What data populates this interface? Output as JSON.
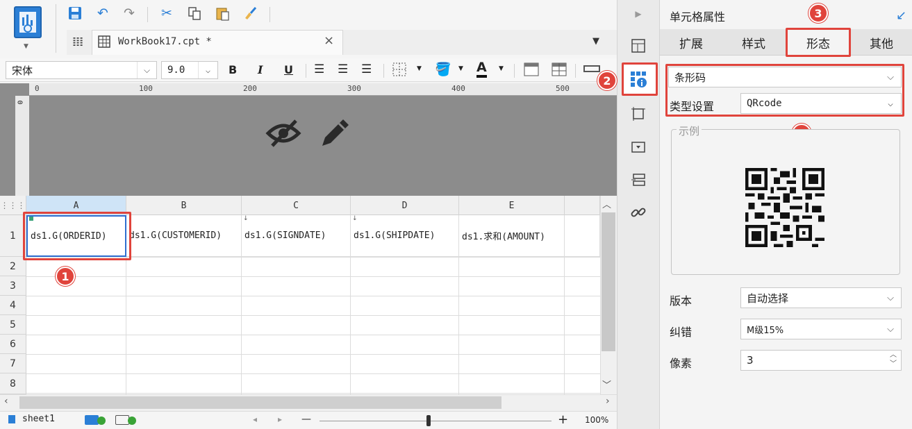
{
  "toolbar": {
    "logo": "report-designer-logo-icon",
    "icons": [
      "save-icon",
      "undo-icon",
      "redo-icon",
      "cut-icon",
      "copy-icon",
      "paste-icon",
      "format-painter-icon"
    ]
  },
  "document_tab": {
    "label": "WorkBook17.cpt *",
    "close": "×"
  },
  "format_bar": {
    "font_name": "宋体",
    "font_size": "9.0",
    "bold": "B",
    "italic": "I",
    "underline": "U",
    "font_color_glyph": "A"
  },
  "ruler": {
    "ticks": [
      "0",
      "100",
      "200",
      "300",
      "400",
      "500"
    ],
    "vertical_tick": "0"
  },
  "grid": {
    "columns": [
      "A",
      "B",
      "C",
      "D",
      "E",
      ""
    ],
    "rows": [
      "1",
      "2",
      "3",
      "4",
      "5",
      "6",
      "7",
      "8"
    ],
    "row1_cells": [
      "ds1.G(ORDERID)",
      "ds1.G(CUSTOMERID)",
      "ds1.G(SIGNDATE)",
      "ds1.G(SHIPDATE)",
      "ds1.求和(AMOUNT)"
    ]
  },
  "status": {
    "sheet_name": "sheet1",
    "zoom": "100%",
    "zoom_minus": "—",
    "zoom_plus": "+"
  },
  "panel": {
    "title": "单元格属性",
    "tabs": [
      "扩展",
      "样式",
      "形态",
      "其他"
    ],
    "active_tab": "形态",
    "type_select": "条形码",
    "type_setting_label": "类型设置",
    "type_setting_value": "QRcode",
    "sample_label": "示例",
    "version_label": "版本",
    "version_value": "自动选择",
    "error_correction_label": "纠错",
    "error_correction_value": "M级15%",
    "pixel_label": "像素",
    "pixel_value": "3"
  },
  "badges": [
    "1",
    "2",
    "3",
    "4"
  ],
  "colors": {
    "accent": "#2b7fd6",
    "highlight": "#e0443c",
    "selected_cell_border": "#2f6fd0"
  }
}
